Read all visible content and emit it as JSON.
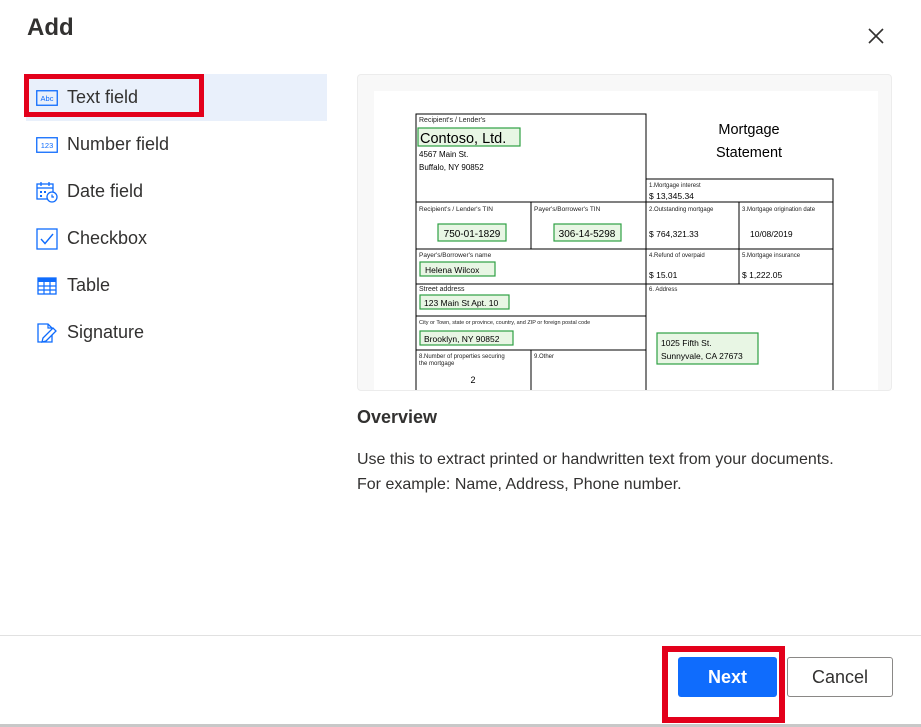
{
  "dialog": {
    "title": "Add"
  },
  "nav": {
    "items": [
      {
        "label": "Text field",
        "icon": "text-field-icon"
      },
      {
        "label": "Number field",
        "icon": "number-field-icon"
      },
      {
        "label": "Date field",
        "icon": "date-field-icon"
      },
      {
        "label": "Checkbox",
        "icon": "checkbox-icon"
      },
      {
        "label": "Table",
        "icon": "table-icon"
      },
      {
        "label": "Signature",
        "icon": "signature-icon"
      }
    ],
    "selected_index": 0
  },
  "preview_doc": {
    "lender_label": "Recipient's / Lender's",
    "lender_name": "Contoso, Ltd.",
    "lender_addr1": "4567 Main St.",
    "lender_addr2": "Buffalo, NY 90852",
    "doc_title_1": "Mortgage",
    "doc_title_2": "Statement",
    "interest_label": "1.Mortgage interest",
    "interest_value": "$  13,345.34",
    "lender_tin_label": "Recipient's / Lender's TIN",
    "lender_tin": "750-01-1829",
    "payer_tin_label": "Payer's/Borrower's TIN",
    "payer_tin": "306-14-5298",
    "outstanding_label": "2.Outstanding mortgage",
    "outstanding_value": "$  764,321.33",
    "origination_label": "3.Mortgage origination date",
    "origination_value": "10/08/2019",
    "payer_name_label": "Payer's/Borrower's name",
    "payer_name": "Helena Wilcox",
    "refund_label": "4.Refund of overpaid",
    "refund_value": "$  15.01",
    "insurance_label": "5.Mortgage insurance",
    "insurance_value": "$  1,222.05",
    "street_label": "Street address",
    "street_value": "123 Main St Apt. 10",
    "address_label": "6. Address",
    "city_label": "City or Town, state or province, country, and ZIP or foreign postal code",
    "city_value": "Brooklyn, NY 90852",
    "address_line1": "1025 Fifth St.",
    "address_line2": "Sunnyvale, CA 27673",
    "properties_label_1": "8.Number of properties securing",
    "properties_label_2": "the mortgage",
    "properties_value": "2",
    "other_label": "9.Other"
  },
  "overview": {
    "title": "Overview",
    "description_line1": "Use this to extract printed or handwritten text from your documents.",
    "description_line2": "For example: Name, Address, Phone number."
  },
  "footer": {
    "next_label": "Next",
    "cancel_label": "Cancel"
  },
  "colors": {
    "accent": "#0f6cfd",
    "highlight": "#e3001b",
    "selected_bg": "#e9f0fb",
    "field_box": "#2ea043"
  }
}
